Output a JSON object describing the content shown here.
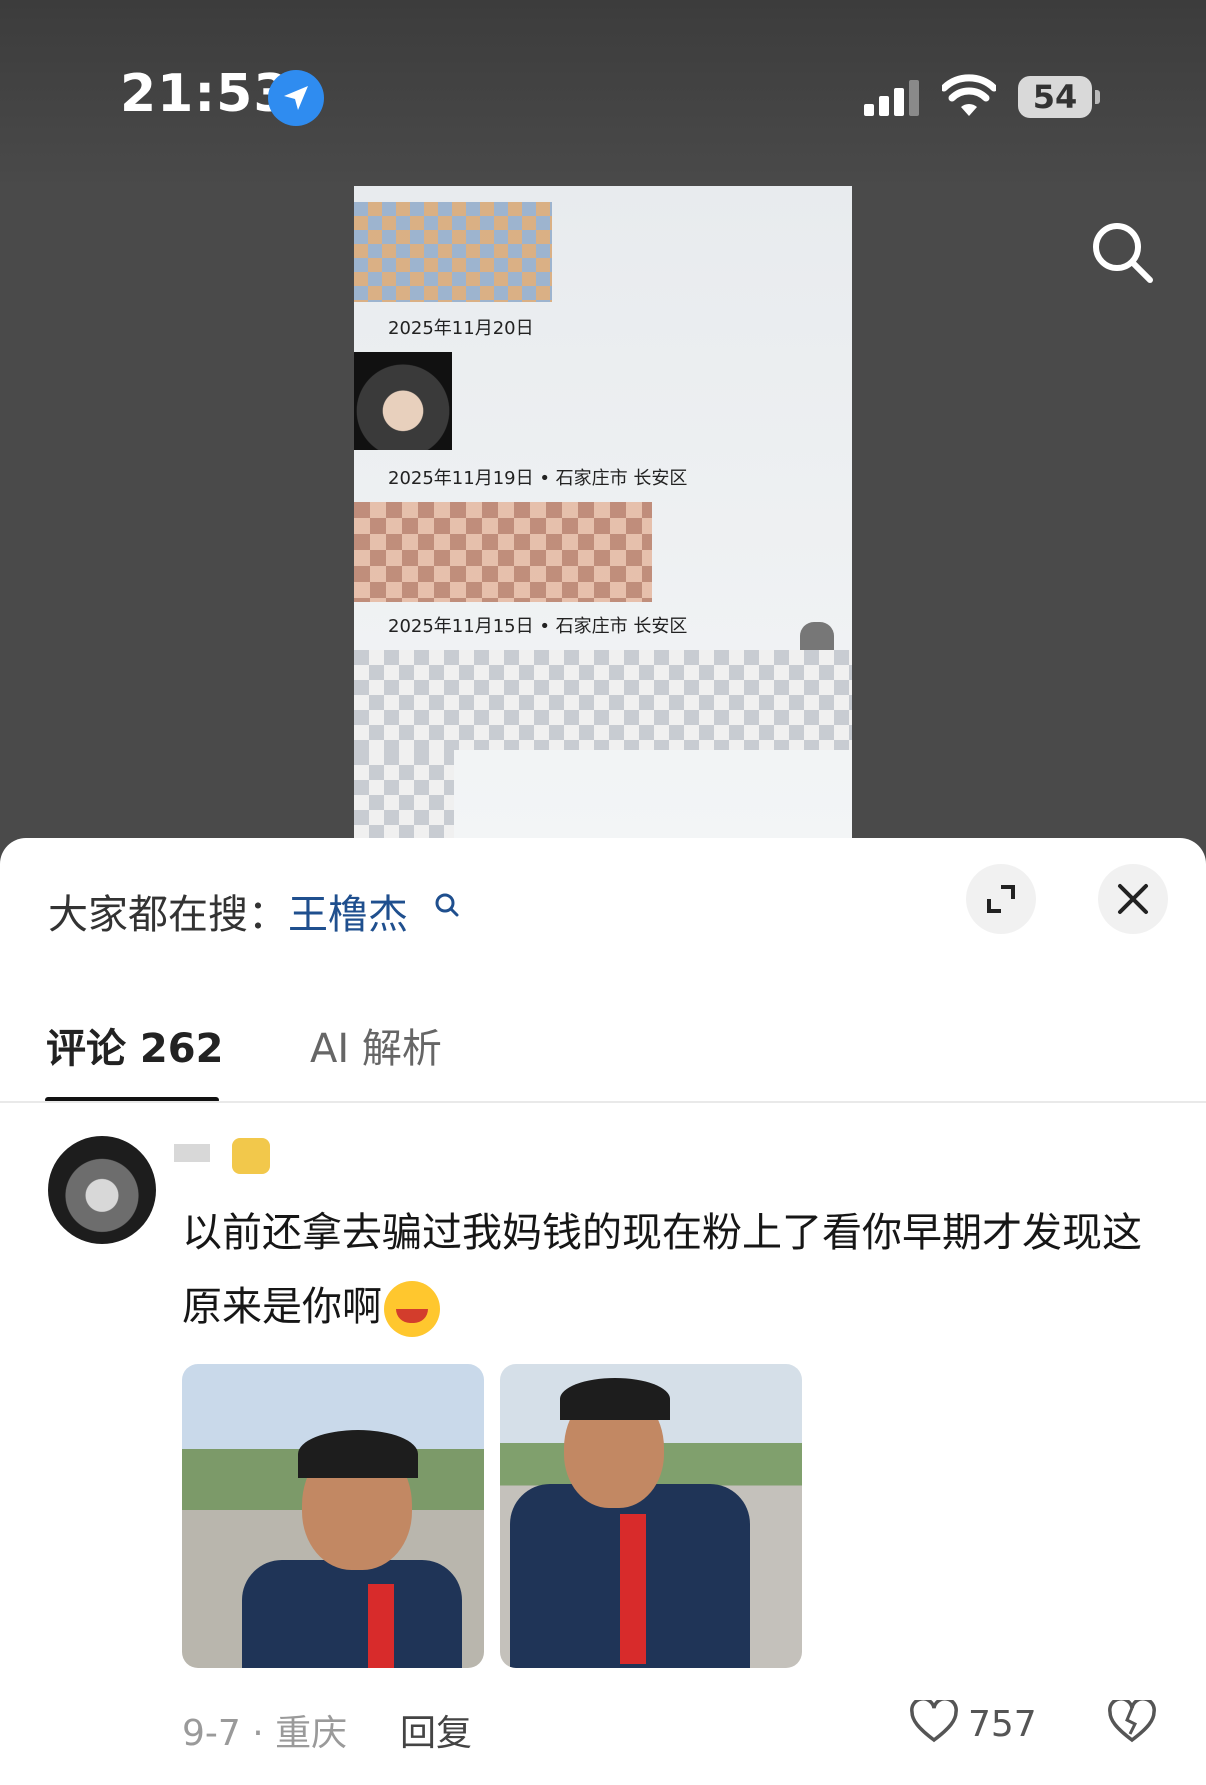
{
  "status_bar": {
    "time": "21:53",
    "battery": "54"
  },
  "video": {
    "dates": [
      "2025年11月20日",
      "2025年11月19日 • 石家庄市 长安区",
      "2025年11月15日 • 石家庄市 长安区"
    ]
  },
  "sheet": {
    "search_prefix": "大家都在搜：",
    "search_keyword": "王橹杰",
    "tabs": {
      "comments": "评论 262",
      "ai": "AI 解析"
    }
  },
  "comment": {
    "text": "以前还拿去骗过我妈钱的现在粉上了看你早期才发现这原来是你啊",
    "emoji": "grinning-face-emoji",
    "meta": "9-7 · 重庆",
    "reply": "回复",
    "likes": "757"
  },
  "colors": {
    "accent_keyword": "#1f4f8e",
    "location_blue": "#2f8cf0"
  }
}
